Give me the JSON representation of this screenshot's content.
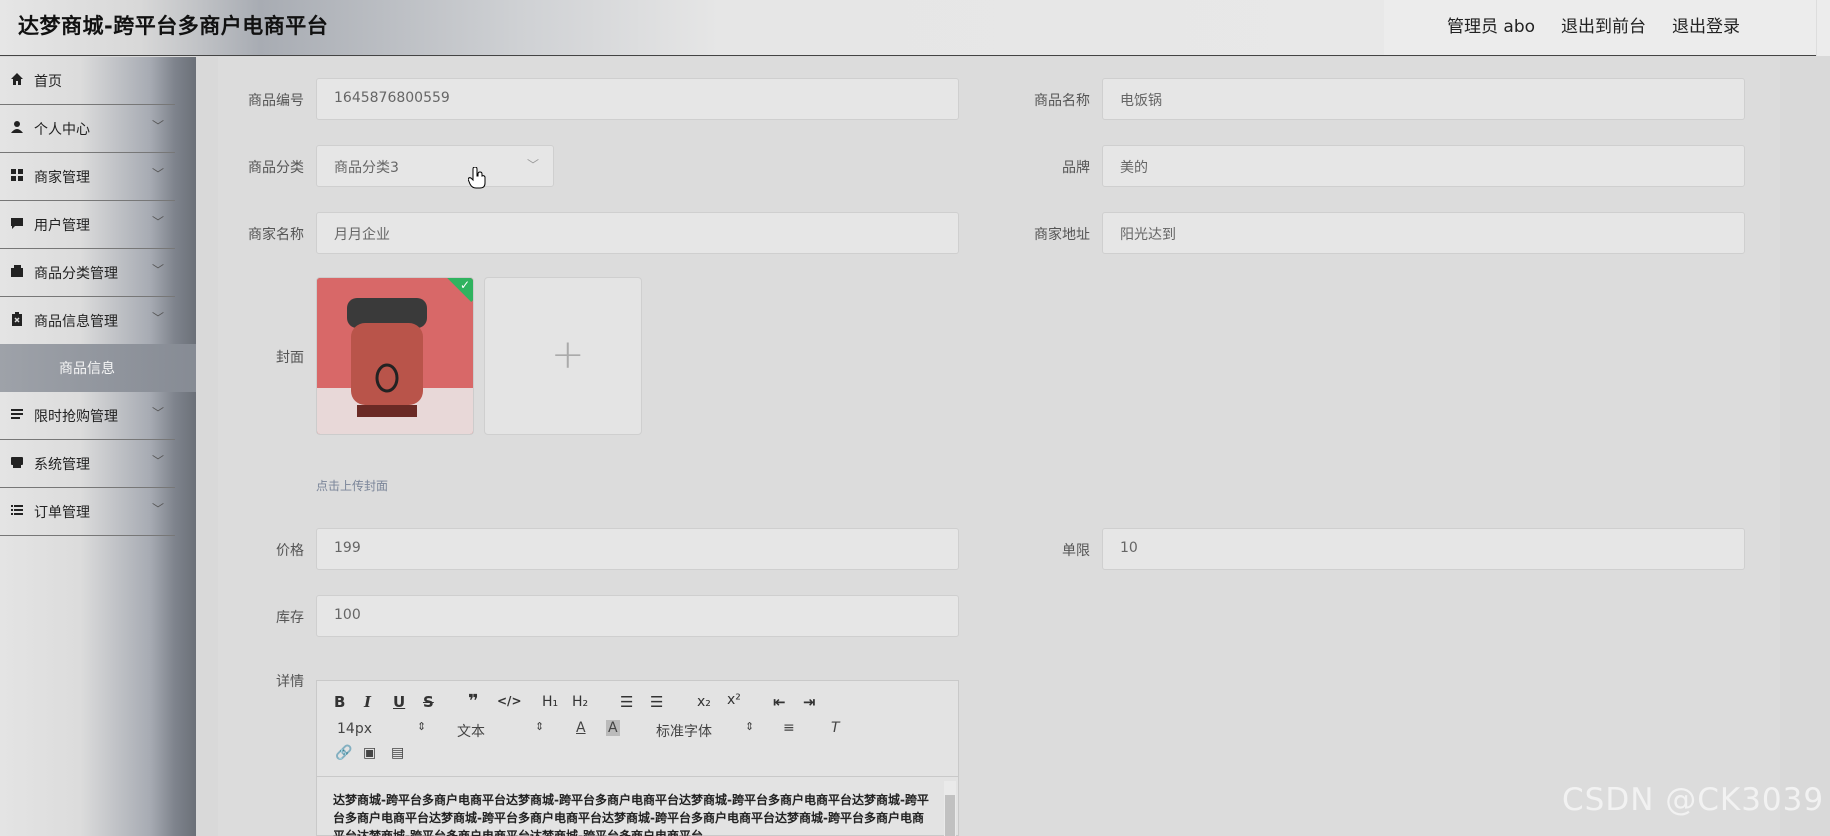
{
  "header": {
    "title": "达梦商城-跨平台多商户电商平台",
    "admin_label": "管理员 abo",
    "to_front": "退出到前台",
    "logout": "退出登录"
  },
  "sidebar": {
    "items": [
      {
        "label": "首页",
        "icon": "home-icon"
      },
      {
        "label": "个人中心",
        "icon": "user-icon"
      },
      {
        "label": "商家管理",
        "icon": "grid-icon"
      },
      {
        "label": "用户管理",
        "icon": "chat-icon"
      },
      {
        "label": "商品分类管理",
        "icon": "wallet-icon"
      },
      {
        "label": "商品信息管理",
        "icon": "clipboard-icon"
      },
      {
        "label": "限时抢购管理",
        "icon": "list-icon"
      },
      {
        "label": "系统管理",
        "icon": "printer-icon"
      },
      {
        "label": "订单管理",
        "icon": "list-icon"
      }
    ],
    "submenu_active": "商品信息"
  },
  "form": {
    "product_no": {
      "label": "商品编号",
      "value": "1645876800559"
    },
    "product_name": {
      "label": "商品名称",
      "value": "电饭锅"
    },
    "category": {
      "label": "商品分类",
      "value": "商品分类3"
    },
    "brand": {
      "label": "品牌",
      "value": "美的"
    },
    "merchant_name": {
      "label": "商家名称",
      "value": "月月企业"
    },
    "merchant_address": {
      "label": "商家地址",
      "value": "阳光达到"
    },
    "cover": {
      "label": "封面",
      "hint": "点击上传封面"
    },
    "price": {
      "label": "价格",
      "value": "199"
    },
    "limit": {
      "label": "单限",
      "value": "10"
    },
    "stock": {
      "label": "库存",
      "value": "100"
    },
    "detail": {
      "label": "详情"
    }
  },
  "editor": {
    "font_size": "14px",
    "text_type": "文本",
    "font_family": "标准字体",
    "content": "达梦商城-跨平台多商户电商平台达梦商城-跨平台多商户电商平台达梦商城-跨平台多商户电商平台达梦商城-跨平台多商户电商平台达梦商城-跨平台多商户电商平台达梦商城-跨平台多商户电商平台达梦商城-跨平台多商户电商平台达梦商城-跨平台多商户电商平台达梦商城-跨平台多商户电商平台"
  },
  "watermark": "CSDN @CK3039",
  "colors": {
    "accent_check": "#2fb35f",
    "submenu_bg": "#8f949c"
  }
}
